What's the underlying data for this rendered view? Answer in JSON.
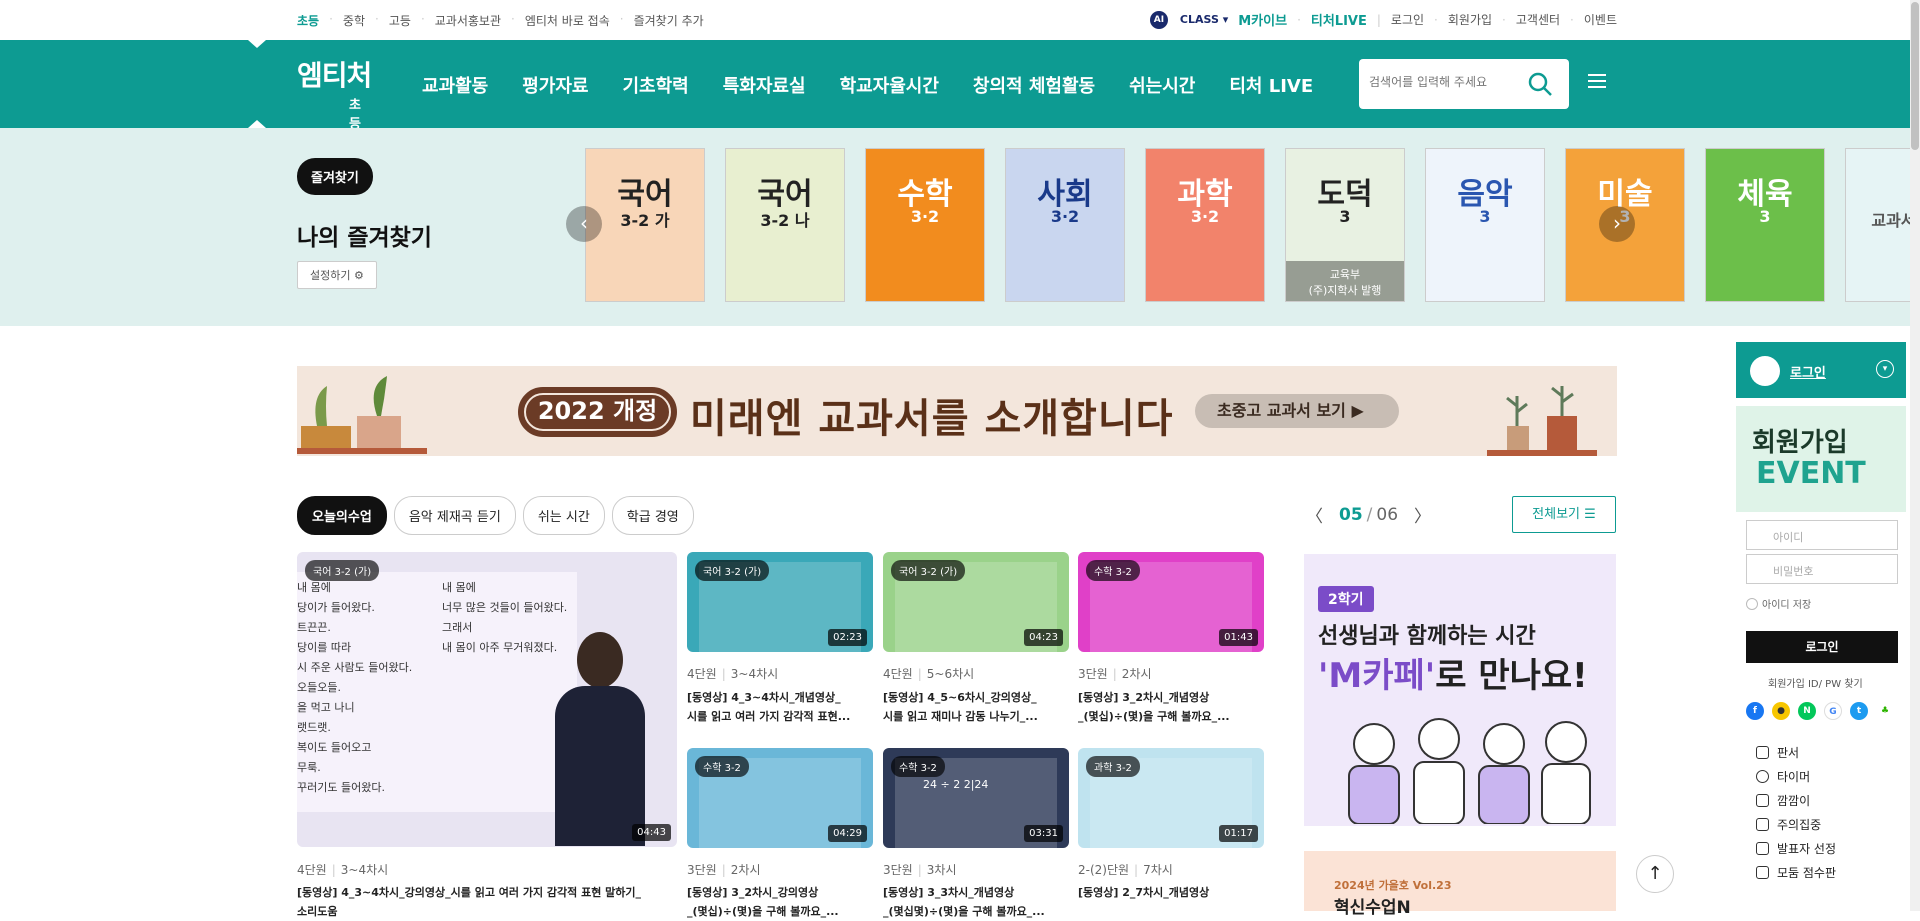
{
  "topbar": {
    "left": [
      "초등",
      "중학",
      "고등",
      "교과서홍보관",
      "엠티처 바로 접속",
      "즐겨찾기 추가"
    ],
    "aiclass": "CLASS",
    "ai": "AI",
    "mcafe": "M카이브",
    "tlive": "티처LIVE",
    "right": [
      "로그인",
      "회원가입",
      "고객센터",
      "이벤트"
    ]
  },
  "gnb": {
    "logo": "엠티처",
    "logo_sub": "초등",
    "menu": [
      "교과활동",
      "평가자료",
      "기초학력",
      "특화자료실",
      "학교자율시간",
      "창의적 체험활동",
      "쉬는시간",
      "티처 LIVE"
    ],
    "search_placeholder": "검색어를 입력해 주세요"
  },
  "favorites": {
    "badge": "즐겨찾기",
    "title": "나의 즐겨찾기",
    "setting": "설정하기 ⚙",
    "books": [
      {
        "title": "국어",
        "grade": "3-2 가",
        "color": "#f8d6b8",
        "tc": "#222"
      },
      {
        "title": "국어",
        "grade": "3-2 나",
        "color": "#e8efd0",
        "tc": "#222"
      },
      {
        "title": "수학",
        "grade": "3·2",
        "color": "#f28c1e",
        "tc": "#fff"
      },
      {
        "title": "사회",
        "grade": "3·2",
        "color": "#c9d6ef",
        "tc": "#1a3a8a"
      },
      {
        "title": "과학",
        "grade": "3·2",
        "color": "#f2836b",
        "tc": "#fff"
      },
      {
        "title": "도덕",
        "grade": "3",
        "color": "#e8f1e2",
        "tc": "#222",
        "overlay1": "교육부",
        "overlay2": "(주)지학사 발행"
      },
      {
        "title": "음악",
        "grade": "3",
        "color": "#eef4fb",
        "tc": "#2a56b0"
      },
      {
        "title": "미술",
        "grade": "3",
        "color": "#f4a23a",
        "tc": "#fff"
      },
      {
        "title": "체육",
        "grade": "3",
        "color": "#6cbf4a",
        "tc": "#fff"
      },
      {
        "title": "",
        "grade": "교과서 E-",
        "color": "#e6f4f5",
        "tc": "#555"
      }
    ]
  },
  "banner": {
    "pill": "2022 개정",
    "headline": "미래엔 교과서를 소개합니다",
    "button": "초중고 교과서 보기 ▶"
  },
  "tabs": [
    "오늘의수업",
    "음악 제재곡 듣기",
    "쉬는 시간",
    "학급 경영"
  ],
  "pager": {
    "current": "05",
    "sep": "/",
    "total": "06"
  },
  "all_button": "전체보기 ☰",
  "videos": [
    {
      "label": "국어 3-2 (가)",
      "dur": "04:43",
      "unit": "4단원",
      "lesson": "3~4차시",
      "title": "[동영상] 4_3~4차시_강의영상_시를 읽고 여러 가지 감각적 표현 말하기_",
      "title2": "소리도움",
      "bg": "#e8e4f2"
    },
    {
      "label": "국어 3-2 (가)",
      "dur": "02:23",
      "unit": "4단원",
      "lesson": "3~4차시",
      "title": "[동영상] 4_3~4차시_개념영상_",
      "title2": "시를 읽고 여러 가지 감각적 표현...",
      "bg": "#3aa8b8"
    },
    {
      "label": "국어 3-2 (가)",
      "dur": "04:23",
      "unit": "4단원",
      "lesson": "5~6차시",
      "title": "[동영상] 4_5~6차시_강의영상_",
      "title2": "시를 읽고 재미나 감동 나누기_...",
      "bg": "#9ad28a"
    },
    {
      "label": "수학 3-2",
      "dur": "01:43",
      "unit": "3단원",
      "lesson": "2차시",
      "title": "[동영상] 3_2차시_개념영상",
      "title2": "_(몇십)÷(몇)을 구해 볼까요_...",
      "bg": "#e040c8"
    },
    {
      "label": "수학 3-2",
      "dur": "04:29",
      "unit": "3단원",
      "lesson": "2차시",
      "title": "[동영상] 3_2차시_강의영상",
      "title2": "_(몇십)÷(몇)을 구해 볼까요_...",
      "bg": "#6ab7d8"
    },
    {
      "label": "수학 3-2",
      "dur": "03:31",
      "unit": "3단원",
      "lesson": "3차시",
      "title": "[동영상] 3_3차시_개념영상",
      "title2": "_(몇십몇)÷(몇)을 구해 볼까요_...",
      "bg": "#2e3a58",
      "math": "24 ÷ 2   2|24"
    },
    {
      "label": "과학 3-2",
      "dur": "01:17",
      "unit": "2-(2)단원",
      "lesson": "7차시",
      "title": "[동영상] 2_7차시_개념영상",
      "title2": "",
      "bg": "#bfe3ef"
    }
  ],
  "lecture_text": [
    "내 몸에",
    "당이가 들어왔다.",
    "트끈끈.",
    "당이를 따라",
    "시 주운 사람도 들어왔다.",
    "오들오들.",
    "을 먹고 나니",
    "랫드랫.",
    "복이도 들어오고",
    "무룩.",
    "꾸러기도 들어왔다."
  ],
  "lecture_text2": [
    "내 몸에",
    "너무 많은 것들이 들어왔다.",
    "그래서",
    "내 몸이 아주 무거워졌다."
  ],
  "promo": {
    "tag": "2학기",
    "line1": "선생님과 함께하는 시간",
    "line2_a": "'M카페'",
    "line2_b": "로 만나요!"
  },
  "promo2": {
    "a": "2024년 가을호 Vol.23",
    "b": "혁신수업N"
  },
  "side": {
    "login": "로그인",
    "ev1": "회원가입",
    "ev2": "EVENT",
    "id_placeholder": "아이디",
    "pw_placeholder": "비밀번호",
    "save": "아이디 저장",
    "login_btn": "로그인",
    "links": "회원가입   ID/ PW 찾기",
    "tools": [
      "판서",
      "타이머",
      "깜깜이",
      "주의집중",
      "발표자 선정",
      "모둠 점수판"
    ]
  }
}
